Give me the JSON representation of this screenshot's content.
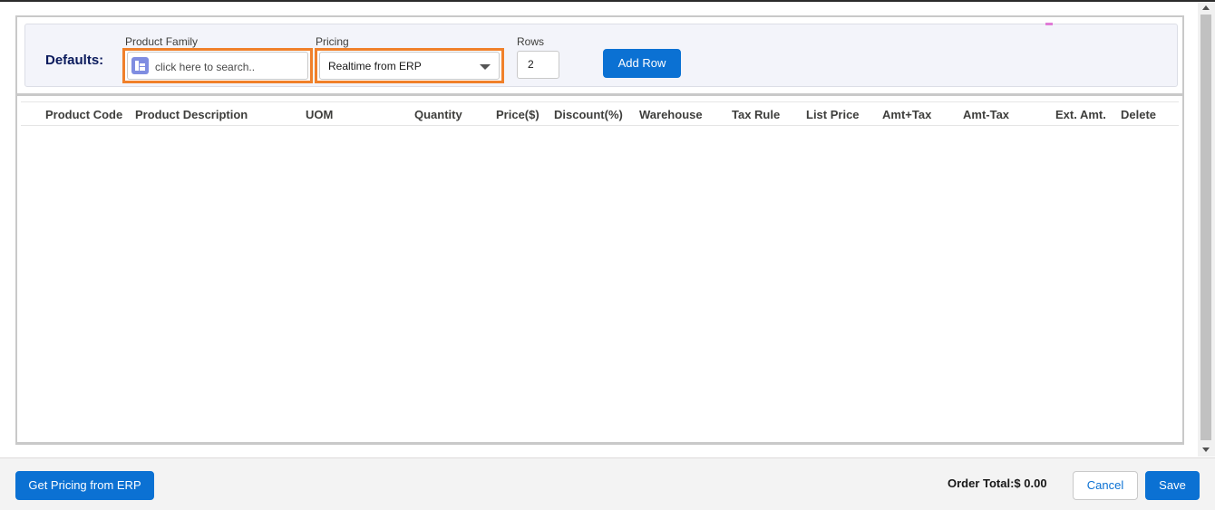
{
  "defaults": {
    "label": "Defaults:",
    "product_family": {
      "label": "Product Family",
      "placeholder": "click here to search.."
    },
    "pricing": {
      "label": "Pricing",
      "selected": "Realtime from ERP"
    },
    "rows": {
      "label": "Rows",
      "value": "2"
    },
    "add_row_label": "Add Row"
  },
  "table": {
    "columns": [
      "Product Code",
      "Product Description",
      "UOM",
      "Quantity",
      "Price($)",
      "Discount(%)",
      "Warehouse",
      "Tax Rule",
      "List Price",
      "Amt+Tax",
      "Amt-Tax",
      "Ext. Amt.",
      "Delete"
    ],
    "rows": []
  },
  "footer": {
    "get_pricing_label": "Get Pricing from ERP",
    "order_total": "Order Total:$ 0.00",
    "cancel_label": "Cancel",
    "save_label": "Save"
  },
  "colors": {
    "brand": "#0b71d3",
    "highlight": "#f0802a",
    "defaults_label": "#0a1a5c",
    "lookup_icon": "#7f8de1"
  }
}
